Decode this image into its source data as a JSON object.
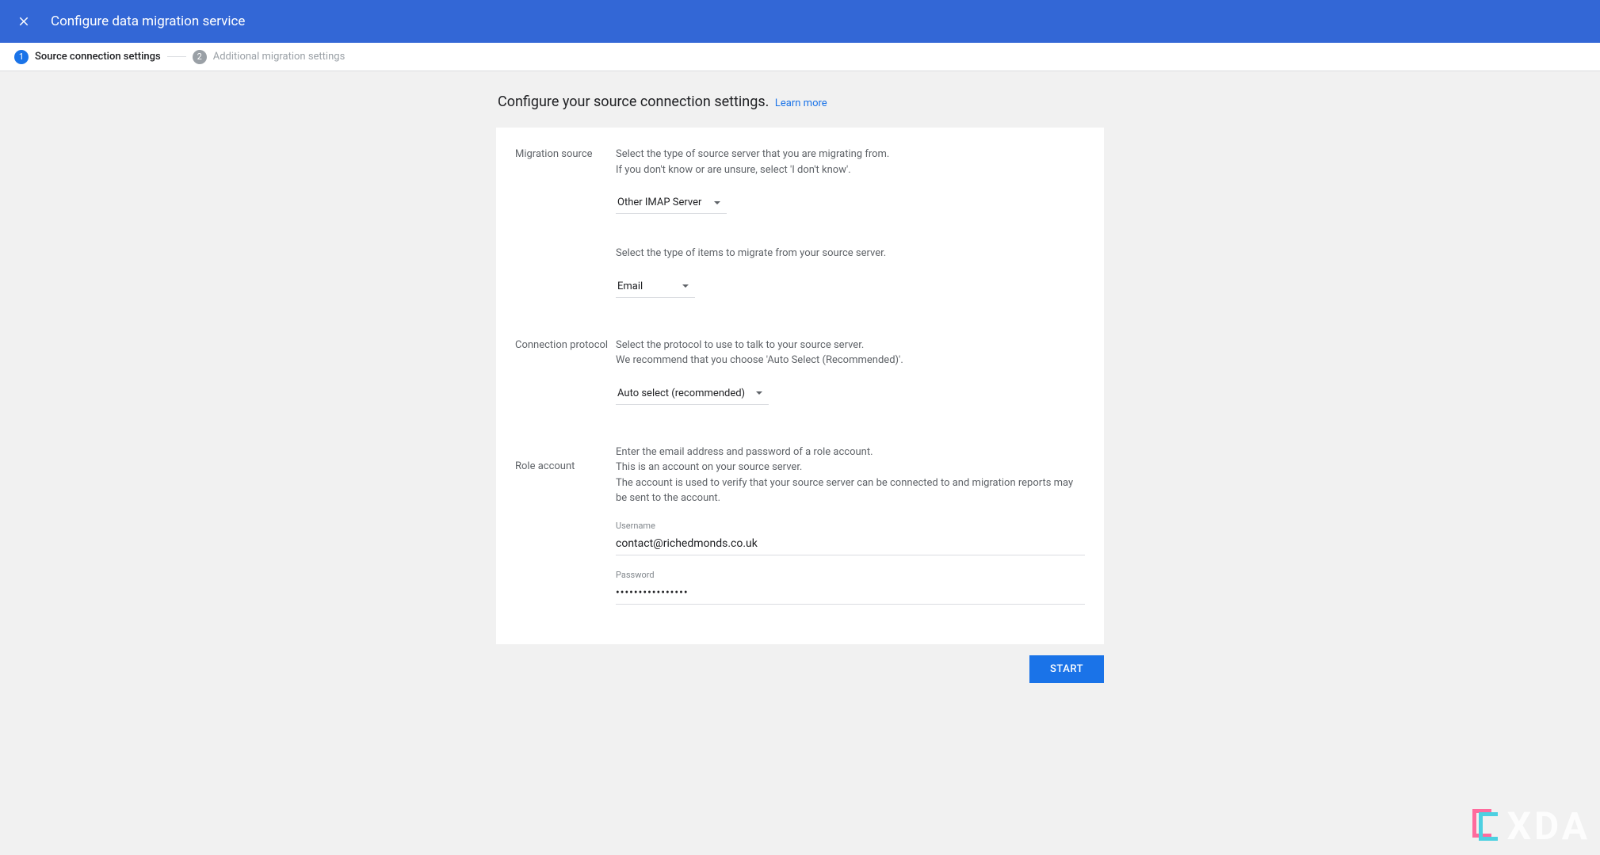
{
  "header": {
    "title": "Configure data migration service"
  },
  "stepper": {
    "step1": {
      "num": "1",
      "label": "Source connection settings"
    },
    "step2": {
      "num": "2",
      "label": "Additional migration settings"
    }
  },
  "content": {
    "title": "Configure your source connection settings.",
    "learn_more": "Learn more"
  },
  "sections": {
    "migration_source": {
      "label": "Migration source",
      "help1_line1": "Select the type of source server that you are migrating from.",
      "help1_line2": "If you don't know or are unsure, select 'I don't know'.",
      "dropdown1_value": "Other IMAP Server",
      "help2": "Select the type of items to migrate from your source server.",
      "dropdown2_value": "Email"
    },
    "connection_protocol": {
      "label": "Connection protocol",
      "help_line1": "Select the protocol to use to talk to your source server.",
      "help_line2": "We recommend that you choose 'Auto Select (Recommended)'.",
      "dropdown_value": "Auto select (recommended)"
    },
    "role_account": {
      "label": "Role account",
      "help_line1": "Enter the email address and password of a role account.",
      "help_line2": "This is an account on your source server.",
      "help_line3": "The account is used to verify that your source server can be connected to and migration reports may be sent to the account.",
      "username_label": "Username",
      "username_value": "contact@richedmonds.co.uk",
      "password_label": "Password",
      "password_value": "••••••••••••••••"
    }
  },
  "buttons": {
    "start": "START"
  },
  "watermark": "XDA"
}
